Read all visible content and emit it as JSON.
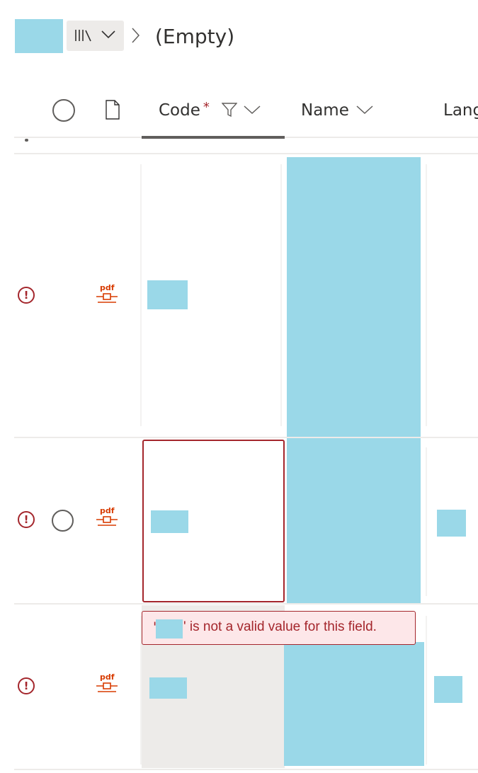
{
  "breadcrumb": {
    "library_icon": "library-icon",
    "dropdown_icon": "chevron-down-icon",
    "separator_icon": "chevron-right-icon",
    "current": "(Empty)"
  },
  "header": {
    "select_all_icon": "circle-icon",
    "file_type_icon": "document-icon",
    "columns": [
      {
        "label": "Code",
        "required": "*",
        "icons": [
          "filter-icon",
          "chevron-down-icon"
        ]
      },
      {
        "label": "Name",
        "icons": [
          "chevron-down-icon"
        ]
      },
      {
        "label": "Lang"
      }
    ]
  },
  "rows": [
    {
      "status_icon": "error-icon",
      "file_icon": "pdf-icon",
      "file_label": "pdf",
      "selected_circle": false
    },
    {
      "status_icon": "error-icon",
      "file_icon": "pdf-icon",
      "file_label": "pdf",
      "selected_circle": true,
      "editing": true
    },
    {
      "status_icon": "error-icon",
      "file_icon": "pdf-icon",
      "file_label": "pdf",
      "selected_circle": false
    }
  ],
  "validation": {
    "message": "' is not a valid value for this field.",
    "open_quote": "'"
  },
  "colors": {
    "redacted": "#9ad8e8",
    "error": "#a4262c",
    "error_bg": "#fde7e9",
    "pdf": "#d83b01"
  }
}
